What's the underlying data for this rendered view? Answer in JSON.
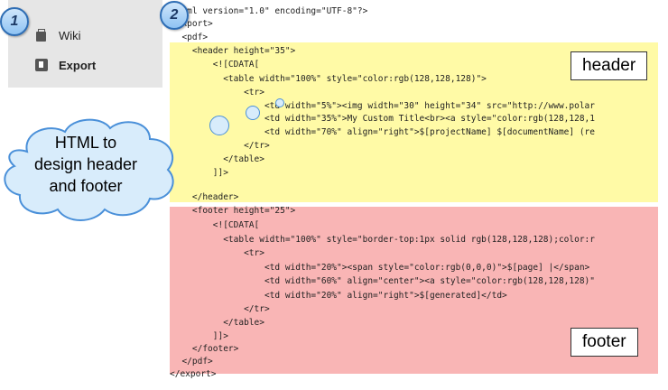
{
  "menu": {
    "items": [
      {
        "label": "Wiki",
        "icon": "wiki-page-icon"
      },
      {
        "label": "Export",
        "icon": "export-icon"
      }
    ]
  },
  "badges": [
    "1",
    "2"
  ],
  "callout": {
    "lines": [
      "HTML to",
      "design header",
      "and footer"
    ]
  },
  "labels": {
    "header": "header",
    "footer": "footer"
  },
  "code_lines": [
    "<?xml version=\"1.0\" encoding=\"UTF-8\"?>",
    "<export>",
    "  <pdf>",
    "    <header height=\"35\">",
    "        <![CDATA[",
    "          <table width=\"100%\" style=\"color:rgb(128,128,128)\">",
    "              <tr>",
    "                  <td width=\"5%\"><img width=\"30\" height=\"34\" src=\"http://www.polar",
    "                  <td width=\"35%\">My Custom Title<br><a style=\"color:rgb(128,128,1",
    "                  <td width=\"70%\" align=\"right\">$[projectName] $[documentName] (re",
    "              </tr>",
    "          </table>",
    "        ]]>",
    "    </header>",
    "    <footer height=\"25\">",
    "        <![CDATA[",
    "          <table width=\"100%\" style=\"border-top:1px solid rgb(128,128,128);color:r",
    "              <tr>",
    "                  <td width=\"20%\"><span style=\"color:rgb(0,0,0)\">$[page] |</span>",
    "                  <td width=\"60%\" align=\"center\"><a style=\"color:rgb(128,128,128)\"",
    "                  <td width=\"20%\" align=\"right\">$[generated]</td>",
    "              </tr>",
    "          </table>",
    "        ]]>",
    "    </footer>",
    "  </pdf>",
    "</export>"
  ],
  "colors": {
    "header_region": "#fffaa6",
    "footer_region": "#f9b5b5",
    "badge_border": "#2e6db4",
    "cloud_fill": "#d8ecfb"
  }
}
